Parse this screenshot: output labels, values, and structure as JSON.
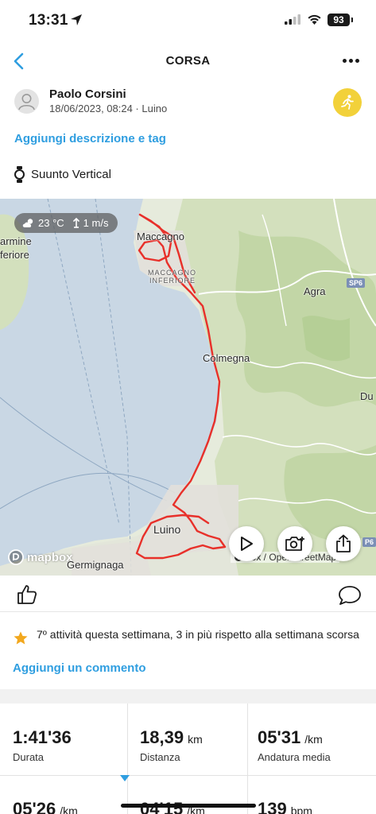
{
  "status_bar": {
    "time": "13:31",
    "battery": "93"
  },
  "nav": {
    "title": "CORSA"
  },
  "user": {
    "name": "Paolo Corsini",
    "meta": "18/06/2023, 08:24 · Luino"
  },
  "add_description_label": "Aggiungi descrizione e tag",
  "device": {
    "name": "Suunto Vertical"
  },
  "map": {
    "weather": {
      "temperature": "23 °C",
      "wind": "1 m/s"
    },
    "labels": {
      "maccagno": "Maccagno",
      "maccagno_inferiore_1": "MACCAGNO",
      "maccagno_inferiore_2": "INFERIORE",
      "agra": "Agra",
      "colmegna": "Colmegna",
      "luino": "Luino",
      "germignaga": "Germignaga",
      "armine": "armine",
      "feriore": "feriore",
      "du": "Du",
      "sp6": "SP6",
      "p6": "P6"
    },
    "mapbox_logo": "mapbox",
    "attribution": "box / OpenStreetMap",
    "route_color": "#e8302a"
  },
  "actions": {},
  "achievement": {
    "text": "7º attività questa settimana, 3 in più rispetto alla settimana scorsa"
  },
  "add_comment_label": "Aggiungi un commento",
  "stats": [
    {
      "value": "1:41'36",
      "unit": "",
      "label": "Durata"
    },
    {
      "value": "18,39",
      "unit": "km",
      "label": "Distanza"
    },
    {
      "value": "05'31",
      "unit": "/km",
      "label": "Andatura media"
    },
    {
      "value": "05'26",
      "unit": "/km",
      "label": ""
    },
    {
      "value": "04'15",
      "unit": "/km",
      "label": ""
    },
    {
      "value": "139",
      "unit": "bpm",
      "label": ""
    }
  ],
  "colors": {
    "accent": "#2f9ee0",
    "badge": "#f2d13a",
    "water": "#c9d7e4"
  }
}
